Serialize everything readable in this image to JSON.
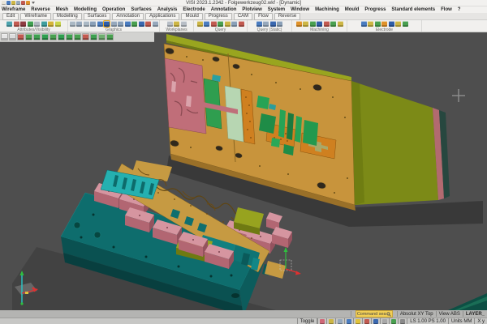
{
  "titlebar": {
    "title": "VISI 2023.1.2342 - Folgewerkzeug02.wkf - [Dynamic]",
    "quick_icons": [
      {
        "c": "#e8e4d8"
      },
      {
        "c": "#4a7cc0"
      },
      {
        "c": "#cdb645"
      },
      {
        "c": "#96a8bc"
      },
      {
        "c": "#c25a50"
      },
      {
        "c": "#e0922a"
      }
    ]
  },
  "menubar": {
    "items": [
      "Wireframe",
      "Reverse",
      "Mesh",
      "Modelling",
      "Operation",
      "Surfaces",
      "Analysis",
      "Electrode",
      "Annotation",
      "Plotview",
      "System",
      "Window",
      "Machining",
      "Mould",
      "Progress",
      "Standard elements",
      "Flow",
      "?"
    ]
  },
  "tabs": {
    "items": [
      "Edit",
      "Wireframe",
      "Modelling",
      "Surfaces",
      "Annotation",
      "Applications",
      "Mould",
      "Progress",
      "CAM",
      "Flow",
      "Reverse"
    ]
  },
  "ribbon": {
    "groups": [
      {
        "label": "Attributes/Visibility",
        "icons": [
          {
            "c": "#4da3ad"
          },
          {
            "c": "#c25a50"
          },
          {
            "c": "#8f3b41"
          },
          {
            "c": "#3fa050"
          },
          {
            "c": "#b0b8c0"
          },
          {
            "c": "#3f9e9e"
          },
          {
            "c": "#d4b43a"
          },
          {
            "c": "#c9d44a"
          }
        ]
      },
      {
        "label": "Graphics",
        "icons": [
          {
            "c": "#aab8c4"
          },
          {
            "c": "#96a8bc"
          },
          {
            "c": "#aab8c4"
          },
          {
            "c": "#8aa0b8"
          },
          {
            "c": "#4a7cc0"
          },
          {
            "c": "#2f5ea8",
            "sel": true
          },
          {
            "c": "#96a8bc"
          },
          {
            "c": "#8aa0b8"
          },
          {
            "c": "#4a7cc0"
          },
          {
            "c": "#49a050"
          },
          {
            "c": "#3a68b0"
          },
          {
            "c": "#c25a50"
          },
          {
            "c": "#96a8bc"
          }
        ]
      },
      {
        "label": "Workplanes",
        "icons": [
          {
            "c": "#b8bec6"
          },
          {
            "c": "#cdb645"
          },
          {
            "c": "#b8bec6"
          }
        ]
      },
      {
        "label": "Query",
        "icons": [
          {
            "c": "#cdb645"
          },
          {
            "c": "#4a7cc0"
          },
          {
            "c": "#c25a50"
          },
          {
            "c": "#49a050"
          },
          {
            "c": "#cdb645"
          },
          {
            "c": "#8aa0b8"
          },
          {
            "c": "#c25a50"
          }
        ]
      },
      {
        "label": "Query (Static)",
        "icons": [
          {
            "c": "#4a7cc0"
          },
          {
            "c": "#96a8bc"
          },
          {
            "c": "#3a68b0"
          },
          {
            "c": "#8aa0b8"
          }
        ]
      },
      {
        "label": "Machining",
        "icons": [
          {
            "c": "#e0922a"
          },
          {
            "c": "#cdb645"
          },
          {
            "c": "#49a050"
          },
          {
            "c": "#2f5ea8"
          },
          {
            "c": "#c25a50"
          },
          {
            "c": "#49a050"
          },
          {
            "c": "#cdb645"
          }
        ]
      },
      {
        "label": "Electrode",
        "icons": [
          {
            "c": "#4a7cc0"
          },
          {
            "c": "#cdb645"
          },
          {
            "c": "#49a050"
          },
          {
            "c": "#e0922a"
          },
          {
            "c": "#2f5ea8"
          },
          {
            "c": "#cdb645"
          },
          {
            "c": "#49a050"
          }
        ]
      }
    ]
  },
  "toolbar2": {
    "icons": [
      {
        "c": "#e6e6e6"
      },
      {
        "c": "#dcdcdc"
      },
      {
        "c": "#c25a50"
      },
      {
        "c": "#49a050"
      },
      {
        "c": "#3fa050"
      },
      {
        "c": "#2f9e4f"
      },
      {
        "c": "#49a050"
      },
      {
        "c": "#2f9e4f"
      },
      {
        "c": "#3fa050"
      },
      {
        "c": "#49a050"
      },
      {
        "c": "#c25a50"
      },
      {
        "c": "#3fa050"
      },
      {
        "c": "#6fae6f"
      },
      {
        "c": "#49a050"
      }
    ]
  },
  "viewport": {
    "colors": {
      "bg": "#4e4e4e",
      "tan": "#c8943c",
      "tan_side": "#9a7028",
      "olive": "#99a51f",
      "olive_side": "#7c8a17",
      "pink_layer": "#b26a70",
      "edge_dark": "#27473f",
      "insert_pink": "#c06e79",
      "green": "#2f9e4f",
      "green_bright": "#27a355",
      "pale_green": "#b7d6b2",
      "orange": "#cf8020",
      "teal_base": "#0e6d6d",
      "teal_side": "#0a5151",
      "teal_dark": "#083f3f",
      "cyan_piece": "#25b0b0",
      "strip_tan": "#c69a42",
      "olive_block": "#97a31f",
      "pink_block": "#d695a0",
      "pink_block_front": "#b26672",
      "pink_block_side": "#94525e"
    }
  },
  "statusbar": {
    "command_search_placeholder": "Command search",
    "coord_mode": "Absolut XY Top",
    "view": "View ABS",
    "layer": "LAYER_",
    "toggle": "Toggle",
    "scale": "LS 1.00 PS 1.00",
    "units": "Units MM",
    "coord_x": "X y",
    "icons": [
      {
        "c": "#d06878"
      },
      {
        "c": "#cdb645"
      },
      {
        "c": "#96a8bc"
      },
      {
        "c": "#4a7cc0"
      },
      {
        "c": "#e0c23a"
      },
      {
        "c": "#c25a50"
      },
      {
        "c": "#3a68b0"
      },
      {
        "c": "#a8a8a8"
      },
      {
        "c": "#49a050"
      },
      {
        "c": "#8a8a8a"
      }
    ]
  }
}
